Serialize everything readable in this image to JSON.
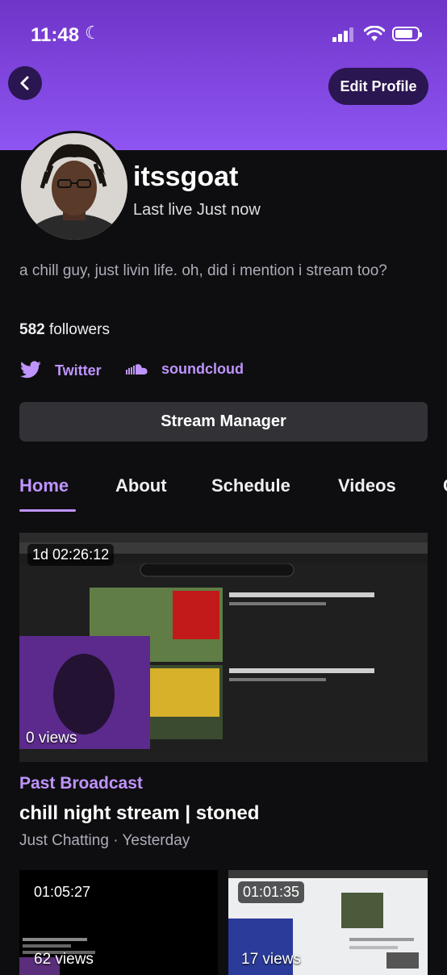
{
  "status_bar": {
    "time": "11:48",
    "battery_level": 0.8
  },
  "header": {
    "edit_label": "Edit Profile"
  },
  "profile": {
    "username": "itssgoat",
    "last_live": "Last live Just now",
    "bio": "a chill guy, just livin life. oh, did i mention i stream too?",
    "followers_count": "582",
    "followers_label": "followers"
  },
  "social": [
    {
      "label": "Twitter",
      "icon": "twitter-icon"
    },
    {
      "label": "soundcloud",
      "icon": "soundcloud-icon"
    }
  ],
  "stream_manager_label": "Stream Manager",
  "tabs": [
    {
      "label": "Home",
      "active": true
    },
    {
      "label": "About"
    },
    {
      "label": "Schedule"
    },
    {
      "label": "Videos"
    }
  ],
  "videos": [
    {
      "duration": "1d 02:26:12",
      "views": "0 views",
      "type": "Past Broadcast",
      "title": "chill night stream | stoned",
      "category": "Just Chatting",
      "date": "Yesterday"
    },
    {
      "duration": "01:05:27",
      "views": "62 views"
    },
    {
      "duration": "01:01:35",
      "views": "17 views"
    }
  ],
  "colors": {
    "accent": "#bf94ff",
    "header_top": "#6f35c9",
    "header_bottom": "#8f55f2",
    "background": "#0e0e10"
  }
}
